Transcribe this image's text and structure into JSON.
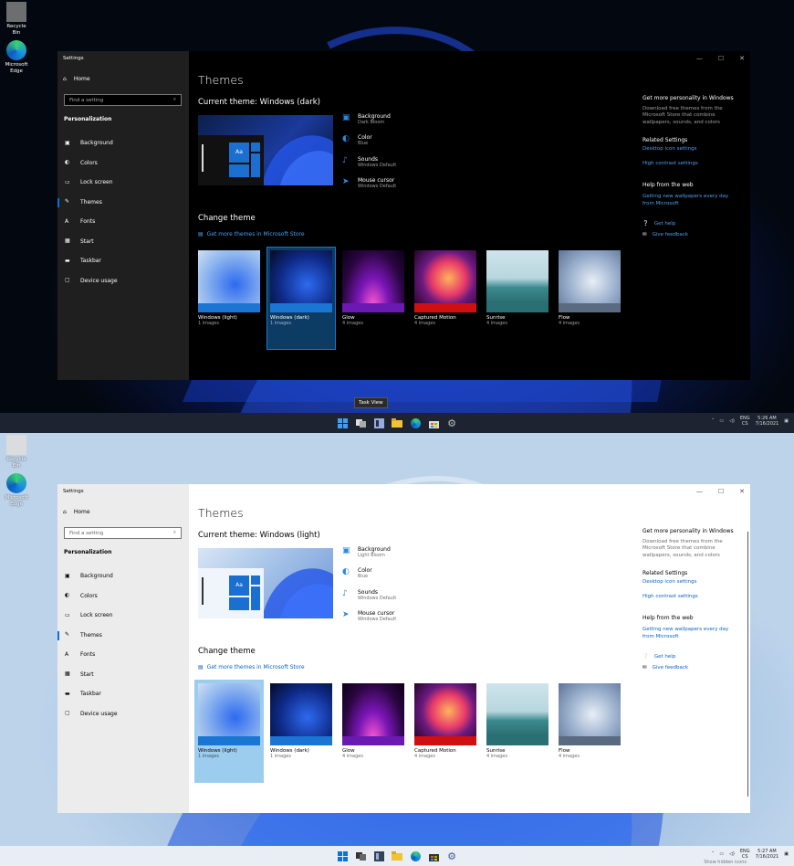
{
  "desktop": {
    "recycle_bin": "Recycle Bin",
    "edge_line1": "Microsoft",
    "edge_line2": "Edge",
    "recycle_bin_2": "Recycle Bin",
    "edge_line1_2": "Microsoft",
    "edge_line2_2": "Edge"
  },
  "dark": {
    "window_title": "Settings",
    "home": "Home",
    "search_placeholder": "Find a setting",
    "section": "Personalization",
    "nav": [
      "Background",
      "Colors",
      "Lock screen",
      "Themes",
      "Fonts",
      "Start",
      "Taskbar",
      "Device usage"
    ],
    "page_title": "Themes",
    "current_theme": "Current theme: Windows (dark)",
    "props": [
      {
        "title": "Background",
        "sub": "Dark Bloom"
      },
      {
        "title": "Color",
        "sub": "Blue"
      },
      {
        "title": "Sounds",
        "sub": "Windows Default"
      },
      {
        "title": "Mouse cursor",
        "sub": "Windows Default"
      }
    ],
    "change_theme": "Change theme",
    "get_more": "Get more themes in Microsoft Store",
    "themes": [
      {
        "name": "Windows (light)",
        "count": "1 images"
      },
      {
        "name": "Windows (dark)",
        "count": "1 images"
      },
      {
        "name": "Glow",
        "count": "4 images"
      },
      {
        "name": "Captured Motion",
        "count": "4 images"
      },
      {
        "name": "Sunrise",
        "count": "4 images"
      },
      {
        "name": "Flow",
        "count": "4 images"
      }
    ],
    "side": {
      "personality_head": "Get more personality in Windows",
      "personality_text": "Download free themes from the Microsoft Store that combine wallpapers, sounds, and colors",
      "related_head": "Related Settings",
      "desktop_icon": "Desktop icon settings",
      "high_contrast": "High contrast settings",
      "help_head": "Help from the web",
      "help_link": "Getting new wallpapers every day from Microsoft",
      "get_help": "Get help",
      "give_feedback": "Give feedback"
    },
    "tray": {
      "lang1": "ENG",
      "lang2": "CS",
      "time": "5:26 AM",
      "date": "7/16/2021"
    },
    "tooltip": "Task View"
  },
  "light": {
    "window_title": "Settings",
    "home": "Home",
    "search_placeholder": "Find a setting",
    "section": "Personalization",
    "nav": [
      "Background",
      "Colors",
      "Lock screen",
      "Themes",
      "Fonts",
      "Start",
      "Taskbar",
      "Device usage"
    ],
    "page_title": "Themes",
    "current_theme": "Current theme: Windows (light)",
    "props": [
      {
        "title": "Background",
        "sub": "Light Bloom"
      },
      {
        "title": "Color",
        "sub": "Blue"
      },
      {
        "title": "Sounds",
        "sub": "Windows Default"
      },
      {
        "title": "Mouse cursor",
        "sub": "Windows Default"
      }
    ],
    "change_theme": "Change theme",
    "get_more": "Get more themes in Microsoft Store",
    "themes": [
      {
        "name": "Windows (light)",
        "count": "1 images"
      },
      {
        "name": "Windows (dark)",
        "count": "1 images"
      },
      {
        "name": "Glow",
        "count": "4 images"
      },
      {
        "name": "Captured Motion",
        "count": "4 images"
      },
      {
        "name": "Sunrise",
        "count": "4 images"
      },
      {
        "name": "Flow",
        "count": "4 images"
      }
    ],
    "side": {
      "personality_head": "Get more personality in Windows",
      "personality_text": "Download free themes from the Microsoft Store that combine wallpapers, sounds, and colors",
      "related_head": "Related Settings",
      "desktop_icon": "Desktop icon settings",
      "high_contrast": "High contrast settings",
      "help_head": "Help from the web",
      "help_link": "Getting new wallpapers every day from Microsoft",
      "get_help": "Get help",
      "give_feedback": "Give feedback"
    },
    "tray": {
      "lang1": "ENG",
      "lang2": "CS",
      "time": "5:27 AM",
      "date": "7/16/2021"
    },
    "hidden_icons": "Show hidden icons"
  },
  "colors": {
    "accent": "#0a72d8",
    "link_dark": "#4aa0f0",
    "link_light": "#0a64c2"
  }
}
